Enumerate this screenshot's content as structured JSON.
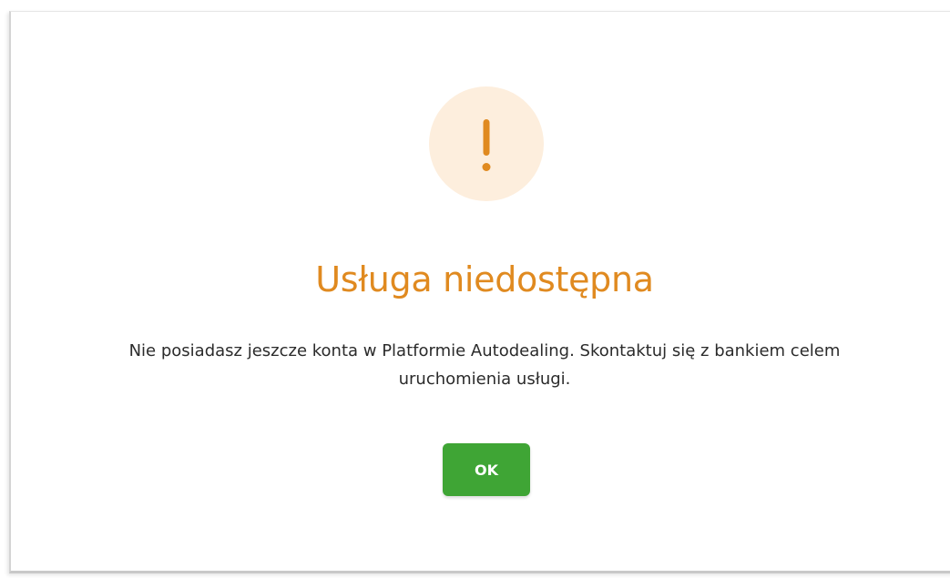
{
  "dialog": {
    "icon": "exclamation-icon",
    "title": "Usługa niedostępna",
    "message": "Nie posiadasz jeszcze konta w Platformie Autodealing. Skontaktuj się z bankiem celem uruchomienia usługi.",
    "ok_label": "OK"
  },
  "colors": {
    "accent": "#e08a20",
    "icon_background": "#fdeedd",
    "button": "#3fa535",
    "text": "#2b2b2b"
  }
}
